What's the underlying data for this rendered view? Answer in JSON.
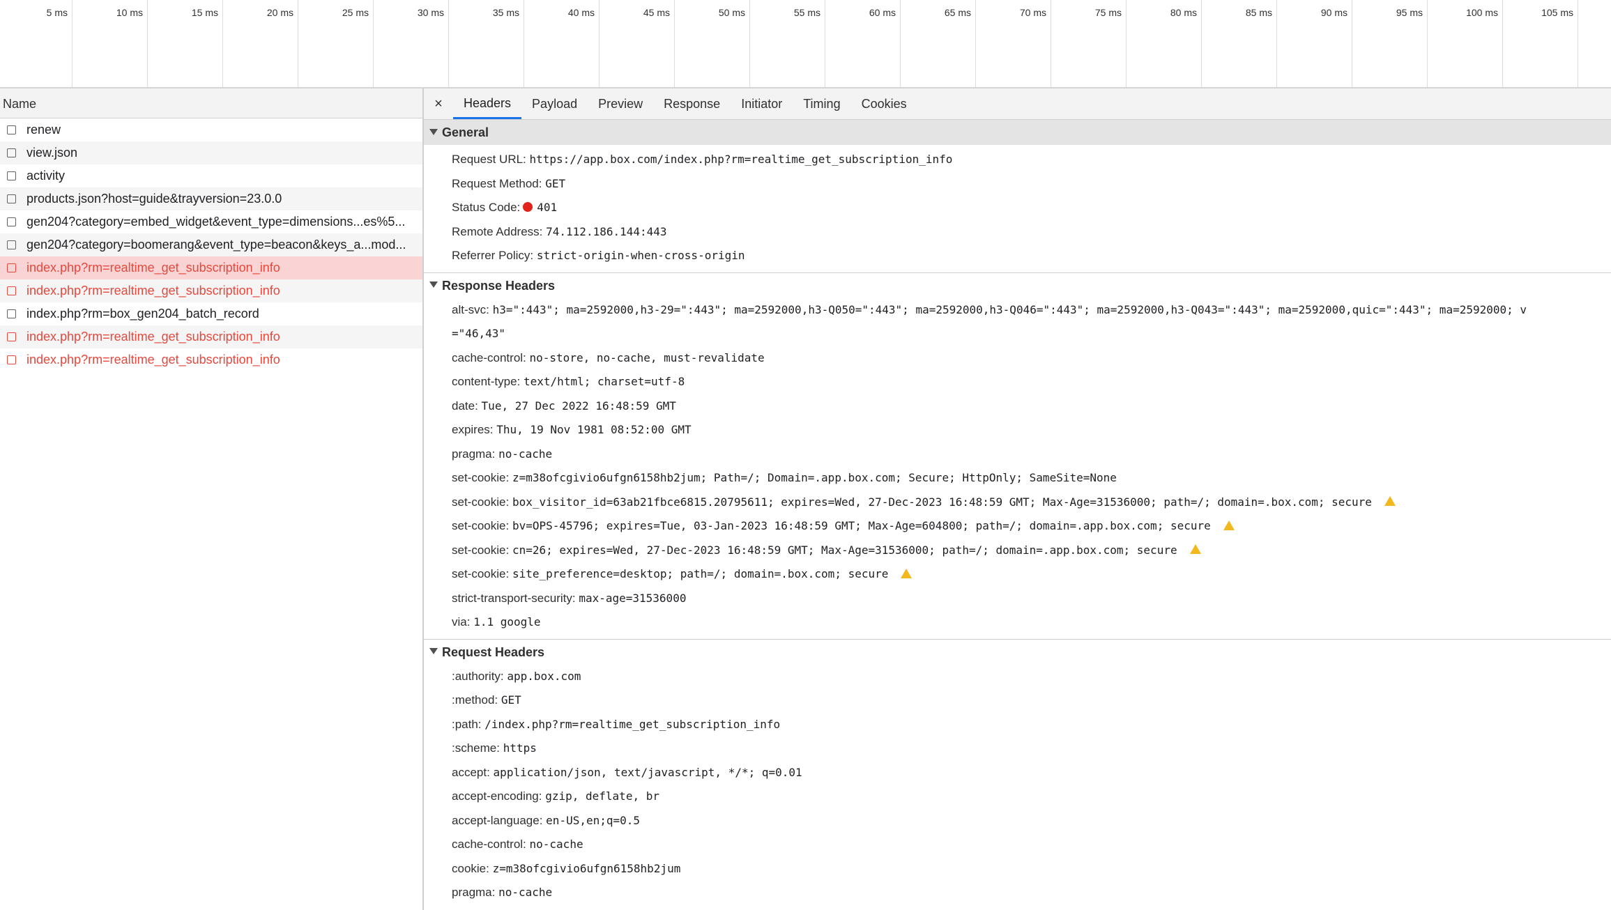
{
  "timeline": {
    "ticks": [
      "5 ms",
      "10 ms",
      "15 ms",
      "20 ms",
      "25 ms",
      "30 ms",
      "35 ms",
      "40 ms",
      "45 ms",
      "50 ms",
      "55 ms",
      "60 ms",
      "65 ms",
      "70 ms",
      "75 ms",
      "80 ms",
      "85 ms",
      "90 ms",
      "95 ms",
      "100 ms",
      "105 ms"
    ]
  },
  "requests": {
    "header": "Name",
    "items": [
      {
        "name": "renew"
      },
      {
        "name": "view.json"
      },
      {
        "name": "activity"
      },
      {
        "name": "products.json?host=guide&trayversion=23.0.0"
      },
      {
        "name": "gen204?category=embed_widget&event_type=dimensions...es%5..."
      },
      {
        "name": "gen204?category=boomerang&event_type=beacon&keys_a...mod..."
      },
      {
        "name": "index.php?rm=realtime_get_subscription_info"
      },
      {
        "name": "index.php?rm=realtime_get_subscription_info"
      },
      {
        "name": "index.php?rm=box_gen204_batch_record"
      },
      {
        "name": "index.php?rm=realtime_get_subscription_info"
      },
      {
        "name": "index.php?rm=realtime_get_subscription_info"
      }
    ]
  },
  "tabs": [
    "Headers",
    "Payload",
    "Preview",
    "Response",
    "Initiator",
    "Timing",
    "Cookies"
  ],
  "close_glyph": "×",
  "general": {
    "title": "General",
    "rows": [
      {
        "key": "Request URL:",
        "value": "https://app.box.com/index.php?rm=realtime_get_subscription_info"
      },
      {
        "key": "Request Method:",
        "value": "GET"
      },
      {
        "key": "Status Code:",
        "value": "401"
      },
      {
        "key": "Remote Address:",
        "value": "74.112.186.144:443"
      },
      {
        "key": "Referrer Policy:",
        "value": "strict-origin-when-cross-origin"
      }
    ]
  },
  "response_headers": {
    "title": "Response Headers",
    "rows": [
      {
        "key": "alt-svc:",
        "value": "h3=\":443\"; ma=2592000,h3-29=\":443\"; ma=2592000,h3-Q050=\":443\"; ma=2592000,h3-Q046=\":443\"; ma=2592000,h3-Q043=\":443\"; ma=2592000,quic=\":443\"; ma=2592000; v",
        "cont": "=\"46,43\""
      },
      {
        "key": "cache-control:",
        "value": "no-store, no-cache, must-revalidate"
      },
      {
        "key": "content-type:",
        "value": "text/html; charset=utf-8"
      },
      {
        "key": "date:",
        "value": "Tue, 27 Dec 2022 16:48:59 GMT"
      },
      {
        "key": "expires:",
        "value": "Thu, 19 Nov 1981 08:52:00 GMT"
      },
      {
        "key": "pragma:",
        "value": "no-cache"
      },
      {
        "key": "set-cookie:",
        "value": "z=m38ofcgivio6ufgn6158hb2jum; Path=/; Domain=.app.box.com; Secure; HttpOnly; SameSite=None"
      },
      {
        "key": "set-cookie:",
        "value": "box_visitor_id=63ab21fbce6815.20795611; expires=Wed, 27-Dec-2023 16:48:59 GMT; Max-Age=31536000; path=/; domain=.box.com; secure",
        "warn": true
      },
      {
        "key": "set-cookie:",
        "value": "bv=OPS-45796; expires=Tue, 03-Jan-2023 16:48:59 GMT; Max-Age=604800; path=/; domain=.app.box.com; secure",
        "warn": true
      },
      {
        "key": "set-cookie:",
        "value": "cn=26; expires=Wed, 27-Dec-2023 16:48:59 GMT; Max-Age=31536000; path=/; domain=.app.box.com; secure",
        "warn": true
      },
      {
        "key": "set-cookie:",
        "value": "site_preference=desktop; path=/; domain=.box.com; secure",
        "warn": true
      },
      {
        "key": "strict-transport-security:",
        "value": "max-age=31536000"
      },
      {
        "key": "via:",
        "value": "1.1 google"
      }
    ]
  },
  "request_headers": {
    "title": "Request Headers",
    "rows": [
      {
        "key": ":authority:",
        "value": "app.box.com"
      },
      {
        "key": ":method:",
        "value": "GET"
      },
      {
        "key": ":path:",
        "value": "/index.php?rm=realtime_get_subscription_info"
      },
      {
        "key": ":scheme:",
        "value": "https"
      },
      {
        "key": "accept:",
        "value": "application/json, text/javascript, */*; q=0.01"
      },
      {
        "key": "accept-encoding:",
        "value": "gzip, deflate, br"
      },
      {
        "key": "accept-language:",
        "value": "en-US,en;q=0.5"
      },
      {
        "key": "cache-control:",
        "value": "no-cache"
      },
      {
        "key": "cookie:",
        "value": "z=m38ofcgivio6ufgn6158hb2jum"
      },
      {
        "key": "pragma:",
        "value": "no-cache"
      }
    ]
  }
}
